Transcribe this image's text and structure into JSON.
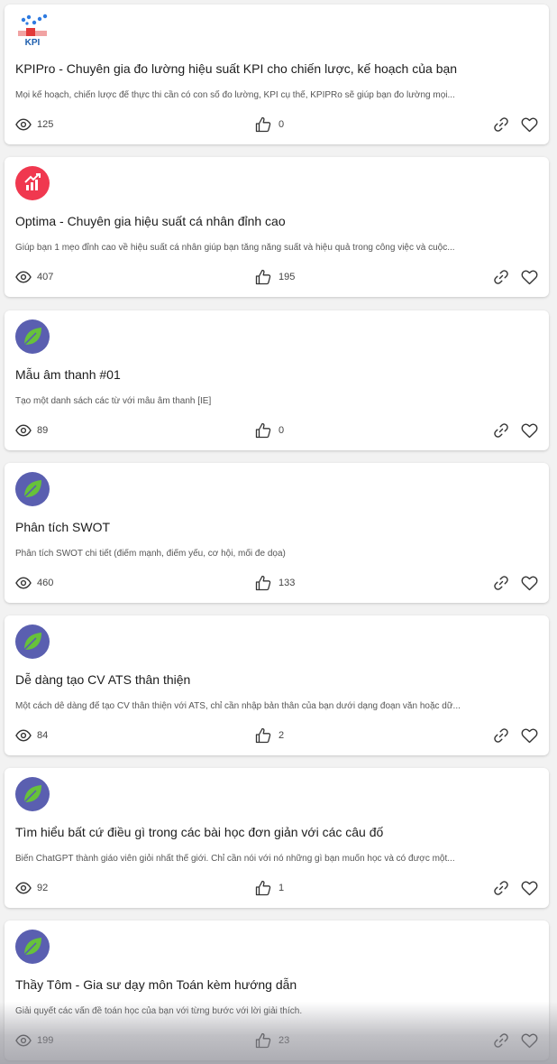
{
  "cards": [
    {
      "avatar": "kpi-logo",
      "avatar_text": "KPI",
      "title": "KPIPro - Chuyên gia đo lường hiệu suất KPI cho chiến lược, kế hoạch của bạn",
      "description": "Mọi kế hoạch, chiến lược để thực thi cần có con số đo lường, KPI cụ thể, KPIPRo sẽ giúp bạn đo lường mọi...",
      "views": "125",
      "likes": "0"
    },
    {
      "avatar": "optima-logo",
      "title": "Optima - Chuyên gia hiệu suất cá nhân đỉnh cao",
      "description": "Giúp bạn 1 mẹo đỉnh cao về hiệu suất cá nhân giúp bạn tăng năng suất và hiệu quả trong công việc và cuộc...",
      "views": "407",
      "likes": "195"
    },
    {
      "avatar": "leaf-logo",
      "title": "Mẫu âm thanh #01",
      "description": "Tạo một danh sách các từ với mẫu âm thanh [IE]",
      "views": "89",
      "likes": "0"
    },
    {
      "avatar": "leaf-logo",
      "title": "Phân tích SWOT",
      "description": "Phân tích SWOT chi tiết (điểm mạnh, điểm yếu, cơ hội, mối đe dọa)",
      "views": "460",
      "likes": "133"
    },
    {
      "avatar": "leaf-logo",
      "title": "Dễ dàng tạo CV ATS thân thiện",
      "description": "Một cách dễ dàng để tạo CV thân thiện với ATS, chỉ cần nhập bản thân của bạn dưới dạng đoạn văn hoặc dữ...",
      "views": "84",
      "likes": "2"
    },
    {
      "avatar": "leaf-logo",
      "title": "Tìm hiểu bất cứ điều gì trong các bài học đơn giản với các câu đố",
      "description": "Biến ChatGPT thành giáo viên giỏi nhất thế giới. Chỉ cần nói với nó những gì bạn muốn học và có được một...",
      "views": "92",
      "likes": "1"
    },
    {
      "avatar": "leaf-logo",
      "title": "Thầy Tôm - Gia sư dạy môn Toán kèm hướng dẫn",
      "description": "Giải quyết các vấn đề toán học của bạn với từng bước với lời giải thích.",
      "views": "199",
      "likes": "23"
    }
  ],
  "icons": {
    "views": "eye-icon",
    "likes": "thumbs-up-icon",
    "copy_link": "link-icon",
    "favorite": "heart-icon"
  },
  "colors": {
    "kpi_blue": "#1f5fae",
    "kpi_red": "#e23a3a",
    "optima_red": "#f0384f",
    "leaf_bg": "#5a5fb0",
    "leaf_green": "#67c23a"
  }
}
